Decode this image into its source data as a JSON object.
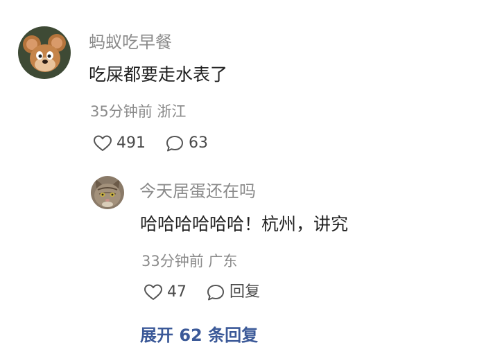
{
  "comment": {
    "username": "蚂蚁吃早餐",
    "text": "吃屎都要走水表了",
    "meta": "35分钟前 浙江",
    "likes": "491",
    "replies": "63"
  },
  "reply": {
    "username": "今天居蛋还在吗",
    "text": "哈哈哈哈哈哈！杭州，讲究",
    "meta": "33分钟前 广东",
    "likes": "47",
    "reply_label": "回复"
  },
  "expand_label": "展开 62 条回复",
  "colors": {
    "username": "#8a8a8a",
    "text": "#1f1f1f",
    "meta": "#8a8a8a",
    "expand": "#3b5998"
  },
  "icons": {
    "like": "heart-outline-icon",
    "comment": "speech-bubble-icon"
  }
}
